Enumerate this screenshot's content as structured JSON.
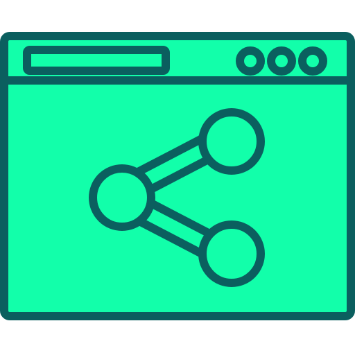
{
  "icon": {
    "name": "browser-share-icon",
    "parts": [
      "browser-window",
      "address-bar",
      "window-control-dots",
      "share-icon"
    ]
  },
  "colors": {
    "fill": "#12FFAA",
    "stroke": "#0B5F5F",
    "background": "#FFFFFF"
  }
}
